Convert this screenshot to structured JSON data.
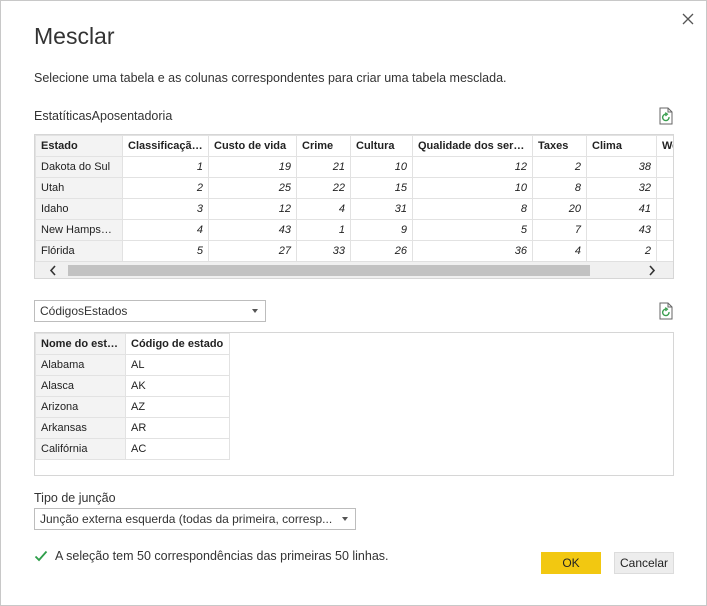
{
  "dialog": {
    "title": "Mesclar",
    "subtitle": "Selecione uma tabela e as colunas correspondentes para criar uma tabela mesclada.",
    "close_icon": "close-icon"
  },
  "table1": {
    "name": "EstatíticasAposentadoria",
    "columns": [
      "Estado",
      "Classificação...",
      "Custo de vida",
      "Crime",
      "Cultura",
      "Qualidade dos serv...",
      "Taxes",
      "Clima",
      "We"
    ],
    "rows": [
      [
        "Dakota do Sul",
        "1",
        "19",
        "21",
        "10",
        "12",
        "2",
        "38"
      ],
      [
        "Utah",
        "2",
        "25",
        "22",
        "15",
        "10",
        "8",
        "32"
      ],
      [
        "Idaho",
        "3",
        "12",
        "4",
        "31",
        "8",
        "20",
        "41"
      ],
      [
        "New Hampshire",
        "4",
        "43",
        "1",
        "9",
        "5",
        "7",
        "43"
      ],
      [
        "Flórida",
        "5",
        "27",
        "33",
        "26",
        "36",
        "4",
        "2"
      ]
    ]
  },
  "table2": {
    "selected": "CódigosEstados",
    "columns": [
      "Nome do estado",
      "Código de estado"
    ],
    "rows": [
      [
        "Alabama",
        "AL"
      ],
      [
        "Alasca",
        "AK"
      ],
      [
        "Arizona",
        "AZ"
      ],
      [
        "Arkansas",
        "AR"
      ],
      [
        "Califórnia",
        "AC"
      ]
    ]
  },
  "join": {
    "label": "Tipo de junção",
    "selected": "Junção externa esquerda (todas da primeira, corresp..."
  },
  "status": {
    "text": "A seleção tem 50 correspondências das primeiras 50 linhas.",
    "icon": "checkmark-icon",
    "color": "#2e9e4a"
  },
  "buttons": {
    "ok": "OK",
    "cancel": "Cancelar"
  },
  "colors": {
    "accent": "#f2c811",
    "refresh_icon": "#3a9e4f"
  }
}
